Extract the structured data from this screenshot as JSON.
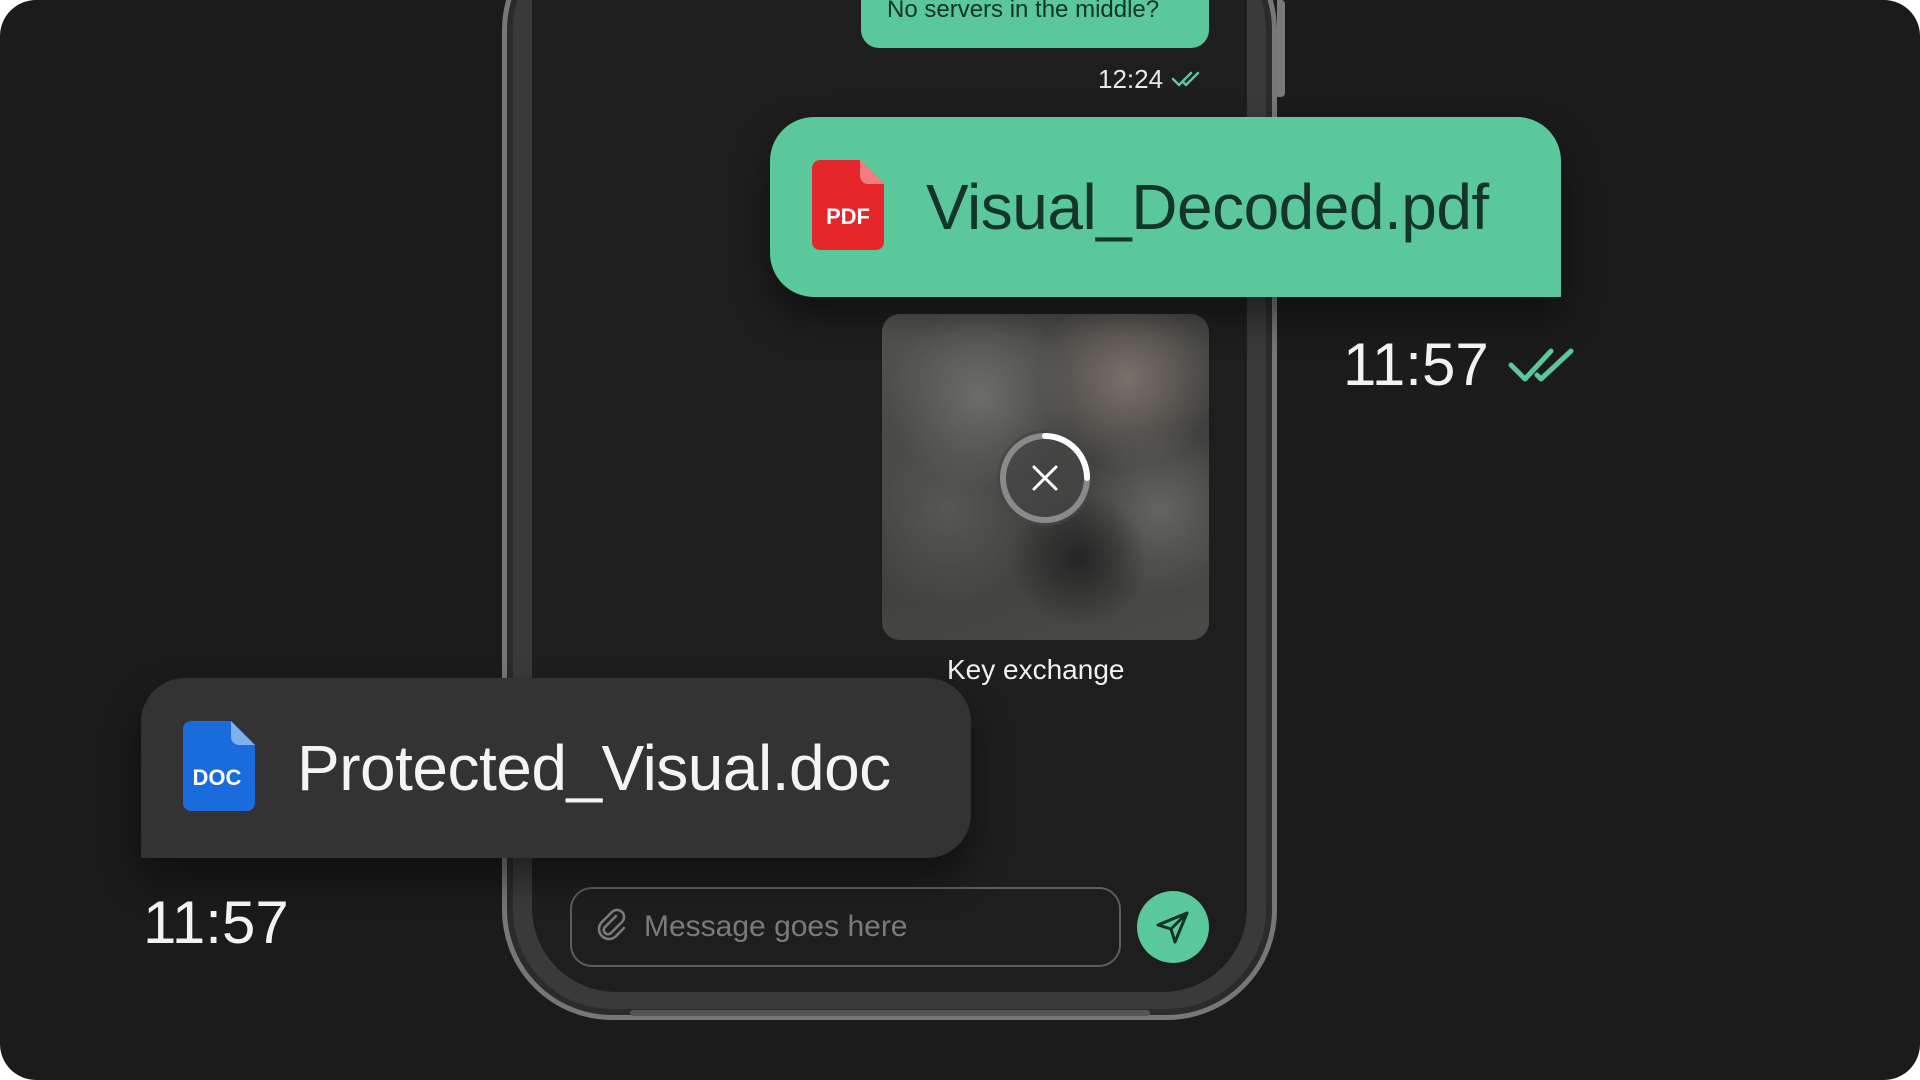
{
  "colors": {
    "background": "#1b1b1b",
    "accent_green": "#5ac89b",
    "bubble_dark": "#333333",
    "pdf_red": "#e5262b",
    "doc_blue": "#1a6bdb"
  },
  "chat": {
    "top_message": "No servers in the middle?",
    "top_message_time": "12:24",
    "media_caption": "Key exchange",
    "input_placeholder": "Message goes here"
  },
  "pdf_message": {
    "file_name": "Visual_Decoded.pdf",
    "badge": "PDF",
    "time": "11:57",
    "status_icon": "double-check-icon"
  },
  "doc_message": {
    "file_name": "Protected_Visual.doc",
    "badge": "DOC",
    "time": "11:57"
  },
  "icons": {
    "attach": "paperclip-icon",
    "send": "send-icon",
    "cancel": "close-icon"
  }
}
